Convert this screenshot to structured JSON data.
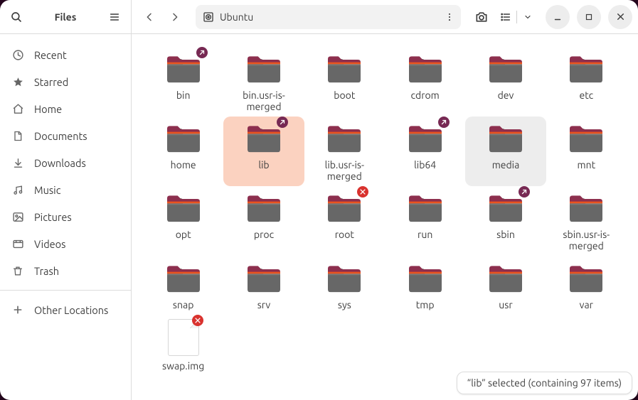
{
  "app_title": "Files",
  "path": {
    "location_icon": "drive-icon",
    "location_label": "Ubuntu"
  },
  "sidebar": {
    "items": [
      {
        "icon": "clock-icon",
        "label": "Recent"
      },
      {
        "icon": "star-icon",
        "label": "Starred"
      },
      {
        "icon": "home-icon",
        "label": "Home"
      },
      {
        "icon": "document-icon",
        "label": "Documents"
      },
      {
        "icon": "download-icon",
        "label": "Downloads"
      },
      {
        "icon": "music-icon",
        "label": "Music"
      },
      {
        "icon": "image-icon",
        "label": "Pictures"
      },
      {
        "icon": "video-icon",
        "label": "Videos"
      },
      {
        "icon": "trash-icon",
        "label": "Trash"
      }
    ],
    "other": {
      "icon": "plus-icon",
      "label": "Other Locations"
    }
  },
  "grid": {
    "items": [
      {
        "name": "bin",
        "type": "folder",
        "badge": "link"
      },
      {
        "name": "bin.usr-is-merged",
        "type": "folder"
      },
      {
        "name": "boot",
        "type": "folder"
      },
      {
        "name": "cdrom",
        "type": "folder"
      },
      {
        "name": "dev",
        "type": "folder"
      },
      {
        "name": "etc",
        "type": "folder"
      },
      {
        "name": "home",
        "type": "folder"
      },
      {
        "name": "lib",
        "type": "folder",
        "badge": "link",
        "selected": true
      },
      {
        "name": "lib.usr-is-merged",
        "type": "folder"
      },
      {
        "name": "lib64",
        "type": "folder",
        "badge": "link"
      },
      {
        "name": "media",
        "type": "folder",
        "hovered": true
      },
      {
        "name": "mnt",
        "type": "folder"
      },
      {
        "name": "opt",
        "type": "folder"
      },
      {
        "name": "proc",
        "type": "folder"
      },
      {
        "name": "root",
        "type": "folder",
        "badge": "deny"
      },
      {
        "name": "run",
        "type": "folder"
      },
      {
        "name": "sbin",
        "type": "folder",
        "badge": "link"
      },
      {
        "name": "sbin.usr-is-merged",
        "type": "folder"
      },
      {
        "name": "snap",
        "type": "folder"
      },
      {
        "name": "srv",
        "type": "folder"
      },
      {
        "name": "sys",
        "type": "folder"
      },
      {
        "name": "tmp",
        "type": "folder"
      },
      {
        "name": "usr",
        "type": "folder"
      },
      {
        "name": "var",
        "type": "folder"
      },
      {
        "name": "swap.img",
        "type": "file",
        "badge": "deny"
      }
    ]
  },
  "status": {
    "text": "“lib” selected  (containing 97 items)"
  }
}
